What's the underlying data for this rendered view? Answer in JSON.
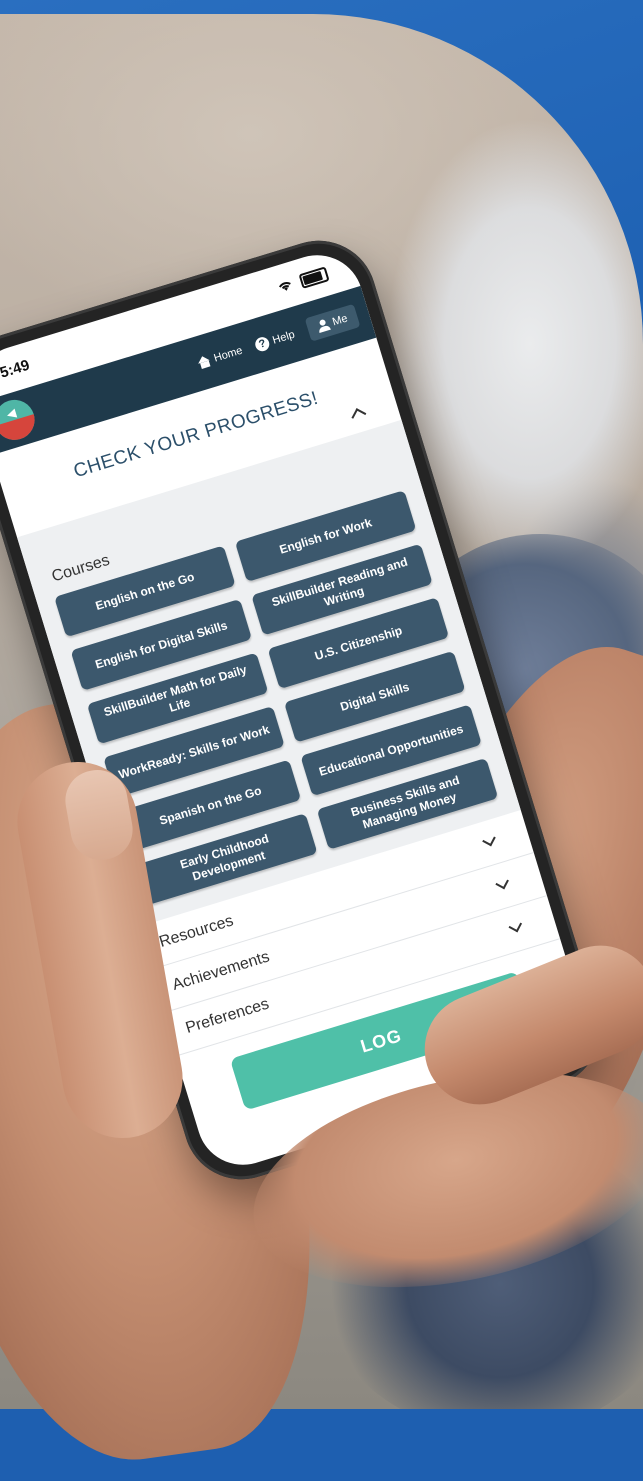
{
  "status_bar": {
    "time": "5:49"
  },
  "nav": {
    "home_label": "Home",
    "help_label": "Help",
    "me_label": "Me"
  },
  "page": {
    "title": "CHECK YOUR PROGRESS!"
  },
  "courses": {
    "label": "Courses",
    "items": [
      "English on the Go",
      "English for Work",
      "English for Digital Skills",
      "SkillBuilder Reading and Writing",
      "SkillBuilder Math for Daily Life",
      "U.S. Citizenship",
      "WorkReady: Skills for Work",
      "Digital Skills",
      "Spanish on the Go",
      "Educational Opportunities",
      "Early Childhood Development",
      "Business Skills and Managing Money"
    ]
  },
  "sections": {
    "resources": "Resources",
    "achievements": "Achievements",
    "preferences": "Preferences"
  },
  "logout_label": "LOG",
  "colors": {
    "navbar": "#1f3a4b",
    "course_button": "#3c586d",
    "logout_button": "#4fc0a8",
    "backdrop_blue": "#1e5fb0"
  },
  "icons": [
    "home-icon",
    "help-icon",
    "user-icon",
    "chevron-up-icon",
    "chevron-down-icon",
    "wifi-icon",
    "battery-icon"
  ]
}
